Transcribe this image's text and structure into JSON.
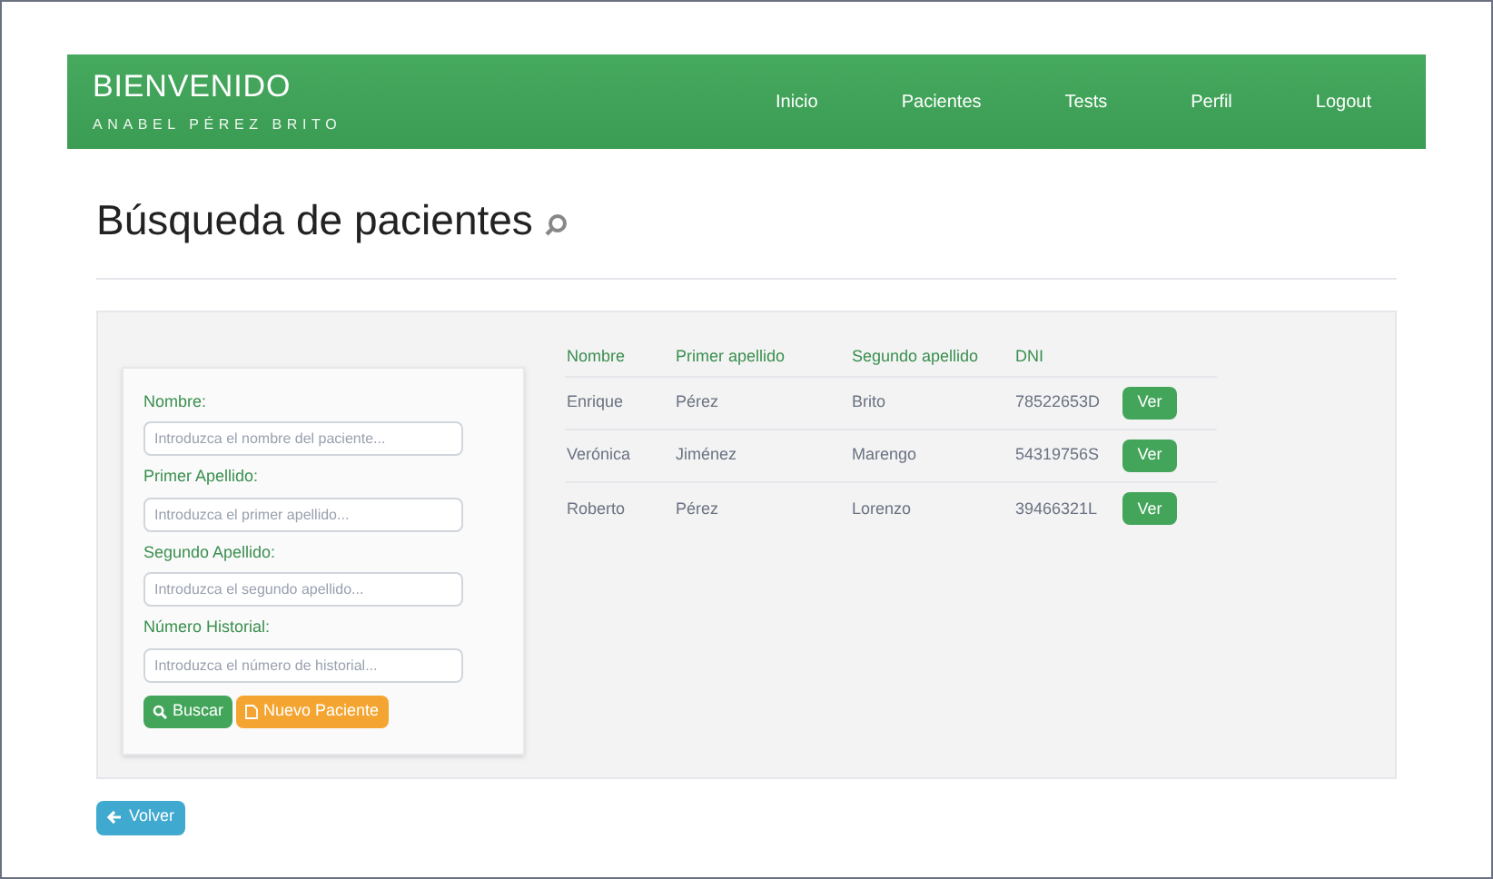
{
  "navbar": {
    "brand": "BIENVENIDO",
    "user": "ANABEL PÉREZ BRITO",
    "links": [
      "Inicio",
      "Pacientes",
      "Tests",
      "Perfil",
      "Logout"
    ]
  },
  "heading": "Búsqueda de pacientes",
  "search_form": {
    "fields": [
      {
        "label": "Nombre:",
        "placeholder": "Introduzca el nombre del paciente..."
      },
      {
        "label": "Primer Apellido:",
        "placeholder": "Introduzca el primer apellido..."
      },
      {
        "label": "Segundo Apellido:",
        "placeholder": "Introduzca el segundo apellido..."
      },
      {
        "label": "Número Historial:",
        "placeholder": "Introduzca el número de historial..."
      }
    ],
    "buttons": [
      {
        "label": "Buscar",
        "kind": "search"
      },
      {
        "label": "Nuevo Paciente",
        "kind": "new"
      }
    ]
  },
  "table": {
    "columns": [
      "Nombre",
      "Primer apellido",
      "Segundo apellido",
      "DNI"
    ],
    "rows": [
      {
        "cells": [
          "Enrique",
          "Pérez",
          "Brito",
          "78522653D"
        ],
        "action": "Ver"
      },
      {
        "cells": [
          "Verónica",
          "Jiménez",
          "Marengo",
          "54319756S"
        ],
        "action": "Ver"
      },
      {
        "cells": [
          "Roberto",
          "Pérez",
          "Lorenzo",
          "39466321L"
        ],
        "action": "Ver"
      }
    ]
  },
  "back_button": "Volver"
}
